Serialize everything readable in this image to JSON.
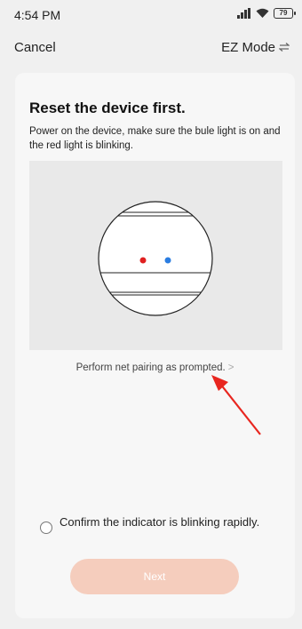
{
  "status_bar": {
    "time": "4:54 PM",
    "battery": "79",
    "icons": [
      "signal-icon",
      "wifi-icon",
      "battery-icon"
    ]
  },
  "nav": {
    "cancel_label": "Cancel",
    "mode_label": "EZ Mode",
    "mode_icon": "switch-arrows-icon"
  },
  "content": {
    "title": "Reset the device first.",
    "description": "Power on the device, make sure the bule light is on and the red light is blinking.",
    "illustration": {
      "red_light_color": "#e02020",
      "blue_light_color": "#2a7de1"
    },
    "pairing_link": "Perform net pairing as prompted.",
    "pairing_chevron": ">",
    "annotation_arrow_color": "#e8261f",
    "confirm_label": "Confirm the indicator is blinking rapidly.",
    "next_label": "Next"
  },
  "colors": {
    "background": "#f0f0f0",
    "card": "#f7f7f7",
    "next_button": "#f5cdbd"
  }
}
